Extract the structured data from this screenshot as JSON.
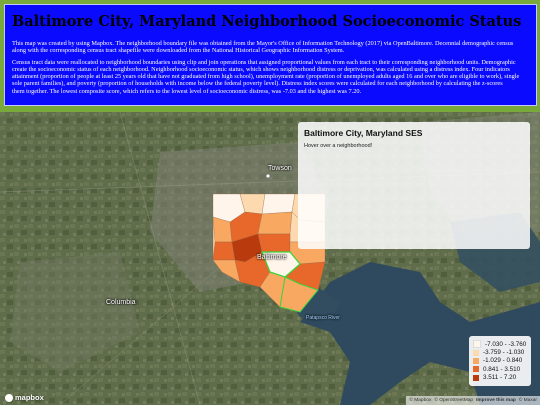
{
  "header": {
    "title": "Baltimore City, Maryland Neighborhood Socioeconomic Status",
    "paragraphs": [
      "This map was created by using Mapbox. The neighborhood boundary file was obtained from the Mayor's Office of Information Technology (2017) via OpenBaltimore. Decennial demographic census",
      "along with the corresponding census tract shapefile were downloaded from the National Historical Geographic Information System.",
      "Census tract data were reallocated to neighborhood boundaries using clip and join operations that assigned proportional values from each tract to their corresponding neighborhood units. Demographic",
      "create the socioeconomic status of each neighborhood. Neighborhood socioeconomic status, which shows neighborhood distress or deprivation, was calculated using a distress index. Four indicators",
      "attainment (proportion of people at least 25 years old that have not graduated from high school), unemployment rate (proportion of unemployed adults aged 16 and over who are eligible to work), single",
      "sole parent families), and poverty (proportion of households with income below the federal poverty level). Distress index scores were calculated for each neighborhood by calculating the z-scores",
      "them together. The lowest composite score, which refers to the lowest level of socioeconomic distress, was -7.03 and the highest was 7.20."
    ]
  },
  "map": {
    "place_labels": {
      "towson": "Towson",
      "baltimore": "Baltimore",
      "columbia": "Columbia",
      "patapsco_river": "Patapsco River"
    },
    "info_panel": {
      "title": "Baltimore City, Maryland SES",
      "hint": "Hover over a neighborhood!"
    },
    "legend": [
      {
        "label": "-7.030 - -3.760",
        "color": "#fff5eb"
      },
      {
        "label": "-3.759 - -1.030",
        "color": "#fdd9b0"
      },
      {
        "label": "-1.029 - 0.840",
        "color": "#f9a862"
      },
      {
        "label": "0.841 - 3.510",
        "color": "#e8672a"
      },
      {
        "label": "3.511 - 7.20",
        "color": "#b93a0c"
      }
    ],
    "logo_text": "mapbox",
    "attribution": {
      "mapbox": "© Mapbox",
      "osm": "© OpenStreetMap",
      "improve": "Improve this map",
      "maxar": "© Maxar"
    }
  }
}
